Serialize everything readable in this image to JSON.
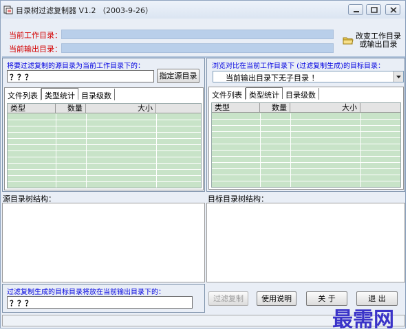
{
  "window": {
    "title": "目录树过滤复制器 V1.2 （2003-9-26）"
  },
  "header": {
    "work_dir_label": "当前工作目录：",
    "out_dir_label": "当前输出目录：",
    "change_button": [
      "改变工作目录",
      "或输出目录"
    ]
  },
  "left": {
    "header": "将要过滤复制的源目录为当前工作目录下的：",
    "source_value": "？？？",
    "specify_button": "指定源目录",
    "tabs": [
      "文件列表",
      "类型统计",
      "目录级数"
    ],
    "active_tab": "类型统计",
    "columns": [
      "类型",
      "数量",
      "大小"
    ],
    "tree_label": "源目录树结构："
  },
  "right": {
    "header": "浏览对比在当前工作目录下 (过滤复制生成)的目标目录：",
    "combo_value": "当前输出目录下无子目录 ！",
    "tabs": [
      "文件列表",
      "类型统计",
      "目录级数"
    ],
    "active_tab": "类型统计",
    "columns": [
      "类型",
      "数量",
      "大小"
    ],
    "tree_label": "目标目录树结构："
  },
  "bottom": {
    "header": "过滤复制生成的目标目录将放在当前输出目录下的：",
    "target_value": "？？？",
    "buttons": {
      "copy": "过滤复制",
      "help": "使用说明",
      "about": "关  于",
      "exit": "退  出"
    }
  },
  "watermark": "最需网",
  "icons": [
    "app-icon",
    "minimize-icon",
    "maximize-icon",
    "close-icon",
    "folder-icon",
    "chevron-down-icon"
  ]
}
